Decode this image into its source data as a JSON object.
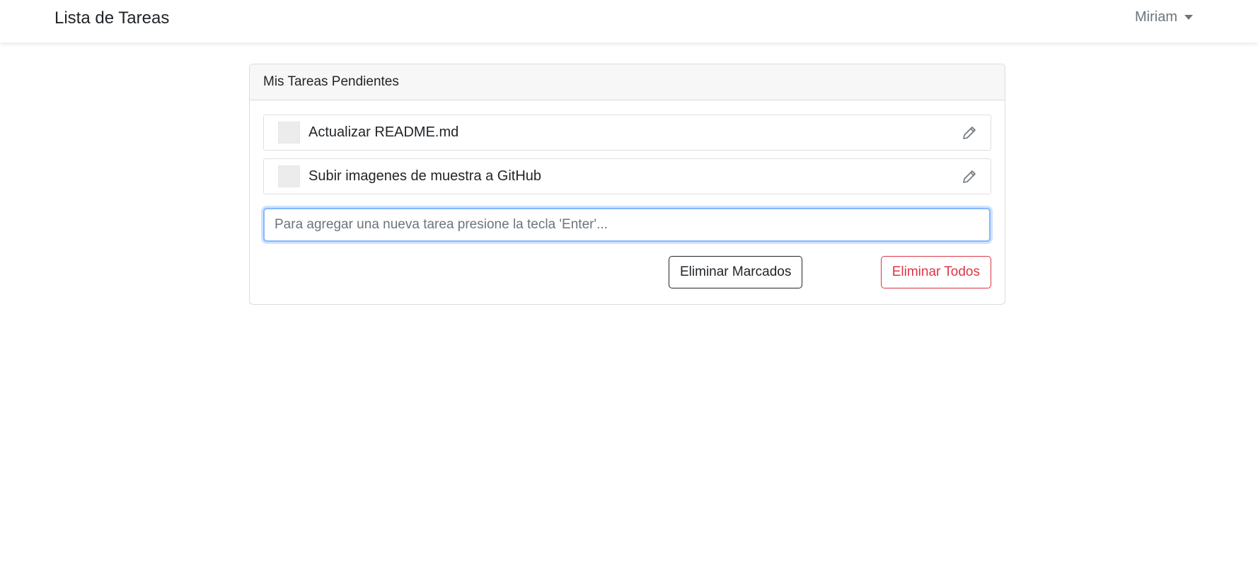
{
  "navbar": {
    "brand": "Lista de Tareas",
    "user": "Miriam",
    "user_menu_icon": "caret-down-icon"
  },
  "card": {
    "title": "Mis Tareas Pendientes",
    "tasks": [
      {
        "text": "Actualizar README.md",
        "checked": false,
        "edit_icon": "pencil-icon"
      },
      {
        "text": "Subir imagenes de muestra a GitHub",
        "checked": false,
        "edit_icon": "pencil-icon"
      }
    ],
    "new_task": {
      "value": "",
      "placeholder": "Para agregar una nueva tarea presione la tecla 'Enter'..."
    },
    "buttons": {
      "delete_marked": "Eliminar Marcados",
      "delete_all": "Eliminar Todos"
    }
  },
  "colors": {
    "danger": "#dc3545",
    "dark": "#212529",
    "focus_border": "#86b7fe",
    "muted": "#6c757d"
  }
}
